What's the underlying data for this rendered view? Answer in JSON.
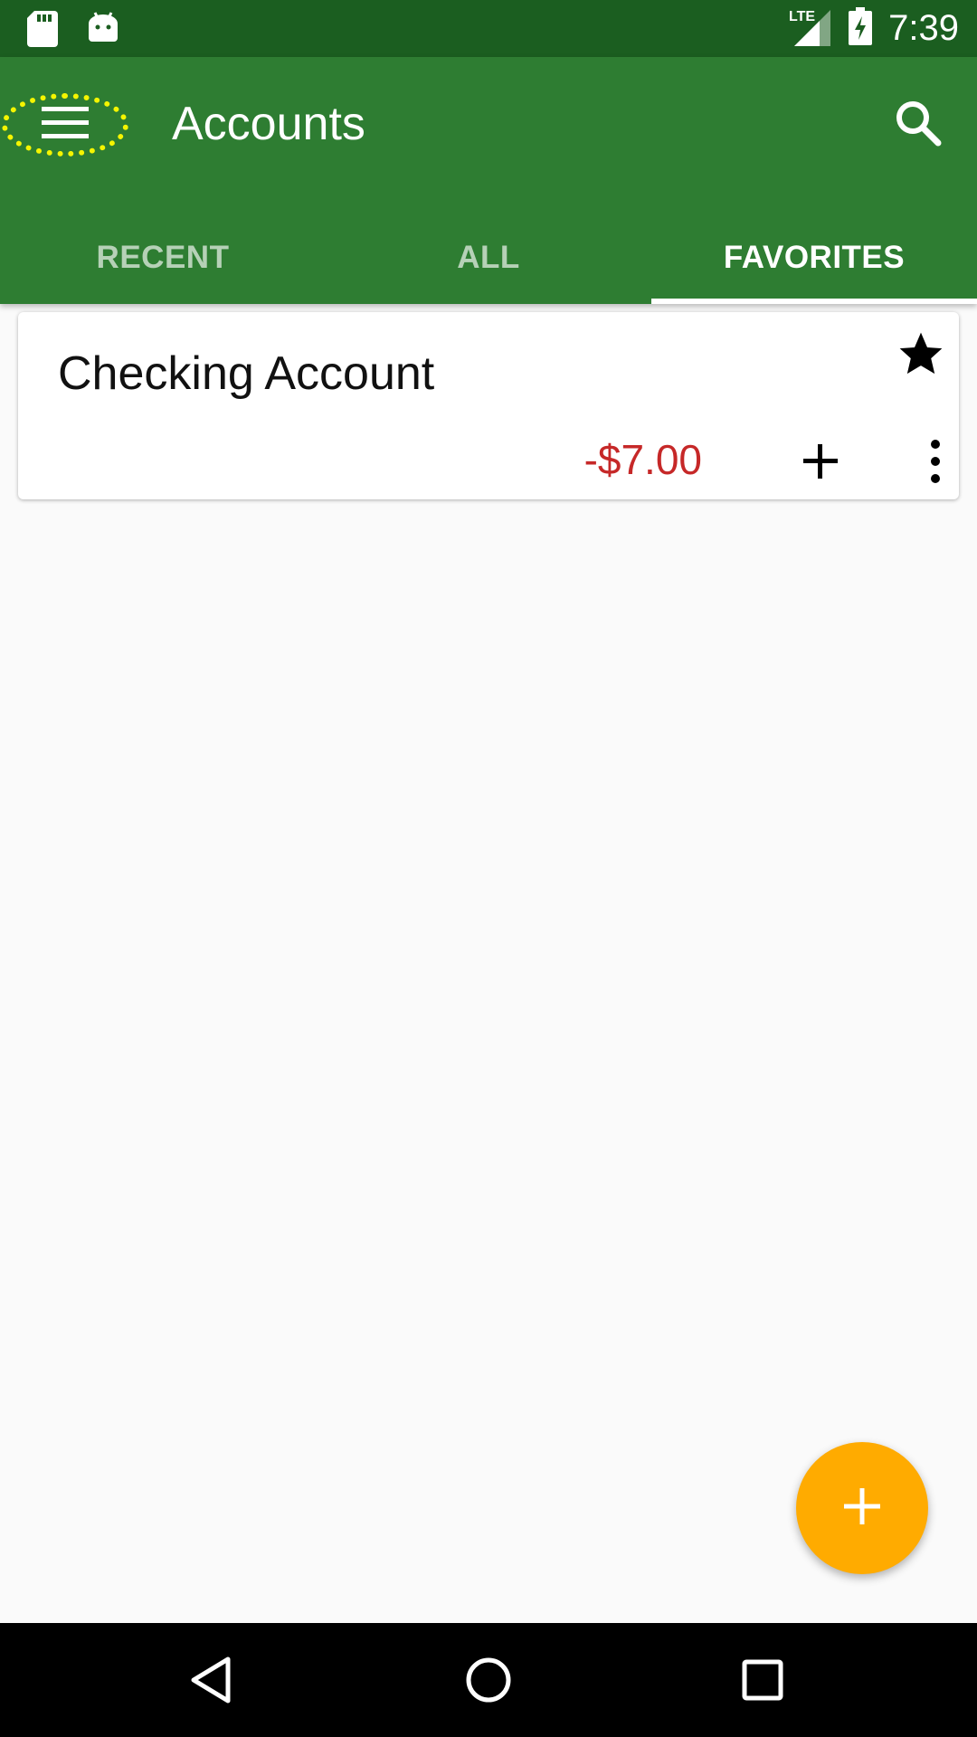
{
  "status_bar": {
    "time": "7:39",
    "network": "LTE",
    "icons": [
      "sd-card-icon",
      "android-icon",
      "signal-icon",
      "battery-charging-icon"
    ]
  },
  "app_bar": {
    "title": "Accounts",
    "menu_icon": "hamburger-menu-icon",
    "search_icon": "search-icon",
    "background_color": "#2e7d32",
    "status_color": "#1b5e20"
  },
  "tabs": [
    {
      "label": "RECENT",
      "active": false
    },
    {
      "label": "ALL",
      "active": false
    },
    {
      "label": "FAVORITES",
      "active": true
    }
  ],
  "accounts": [
    {
      "name": "Checking Account",
      "balance": "-$7.00",
      "balance_color": "#c62828",
      "favorite": true
    }
  ],
  "fab": {
    "icon": "plus-icon",
    "color": "#ffab00"
  },
  "nav_bar": {
    "icons": [
      "back-icon",
      "home-icon",
      "recents-icon"
    ]
  }
}
